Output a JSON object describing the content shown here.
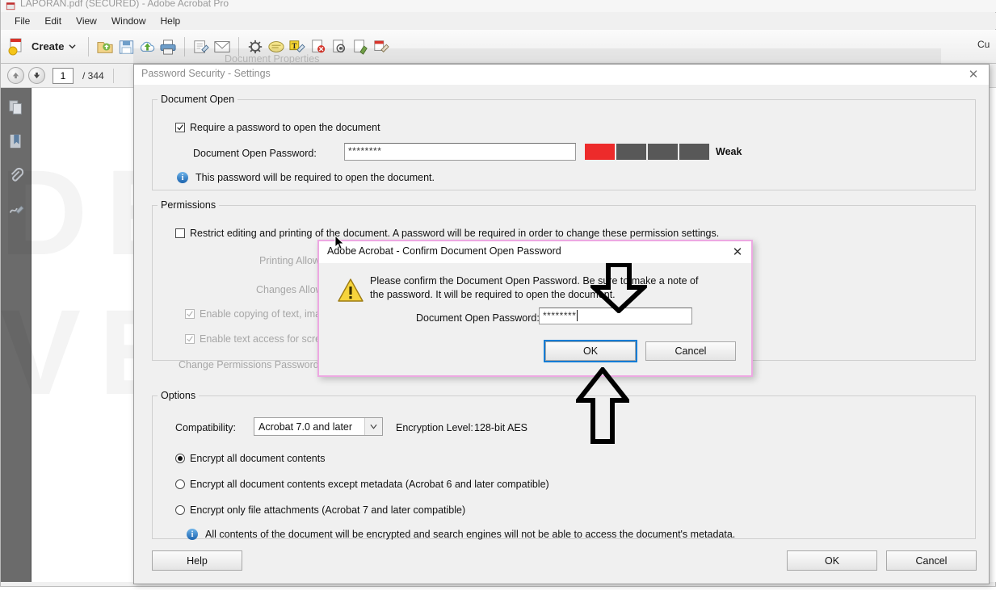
{
  "window": {
    "title": "LAPORAN.pdf (SECURED) - Adobe Acrobat Pro",
    "menu": [
      "File",
      "Edit",
      "View",
      "Window",
      "Help"
    ],
    "toolbar": {
      "create_label": "Create",
      "right_label": "Cu",
      "icons": [
        "create-pdf-icon",
        "open-file-icon",
        "save-icon",
        "upload-cloud-icon",
        "print-icon",
        "sign-icon",
        "email-icon",
        "tools-gear-icon",
        "comment-icon",
        "edit-text-icon",
        "protect-icon",
        "stamp-icon",
        "export-icon",
        "fill-sign-icon"
      ]
    },
    "navbar": {
      "page_current": "1",
      "page_total": "/ 344"
    },
    "rail_icons": [
      "page-thumbnails-icon",
      "bookmarks-icon",
      "attachments-icon",
      "signatures-icon"
    ],
    "watermark": "DEMO VERSION",
    "ghost_tooltip": "Document Properties"
  },
  "settings_dialog": {
    "title": "Password Security - Settings",
    "close_label": "✕",
    "document_open": {
      "legend": "Document Open",
      "require_password_label": "Require a password to open the document",
      "require_password_checked": true,
      "password_label": "Document Open Password:",
      "password_value": "********",
      "strength_label": "Weak",
      "strength_filled": 1,
      "strength_total": 4,
      "strength_color": "#ED2B2B",
      "strength_empty_color": "#585858",
      "info_text": "This password will be required to open the document."
    },
    "permissions": {
      "legend": "Permissions",
      "restrict_label": "Restrict editing and printing of the document. A password will be required in order to change these permission settings.",
      "restrict_checked": false,
      "printing_allowed_label": "Printing Allowed:",
      "changes_allowed_label": "Changes Allowed:",
      "enable_copy_label": "Enable copying of text, image",
      "enable_copy_checked": true,
      "enable_screen_reader_label": "Enable text access for screen r",
      "enable_screen_reader_checked": true,
      "change_perm_password_label": "Change Permissions Password:"
    },
    "options": {
      "legend": "Options",
      "compatibility_label": "Compatibility:",
      "compatibility_value": "Acrobat 7.0 and later",
      "encryption_level_label": "Encryption  Level:",
      "encryption_level_value": "128-bit AES",
      "radios": [
        {
          "label": "Encrypt all document contents",
          "selected": true
        },
        {
          "label": "Encrypt all document contents except metadata (Acrobat 6 and later compatible)",
          "selected": false
        },
        {
          "label": "Encrypt only file attachments (Acrobat 7 and later compatible)",
          "selected": false
        }
      ],
      "info_text": "All contents of the document will be encrypted and search engines will not be able to access the document's metadata."
    },
    "footer": {
      "help_label": "Help",
      "ok_label": "OK",
      "cancel_label": "Cancel"
    }
  },
  "confirm_dialog": {
    "title": "Adobe Acrobat - Confirm Document Open Password",
    "close_label": "✕",
    "message": "Please confirm the Document Open Password. Be sure to make a note of the password. It will be required to open the document.",
    "password_label": "Document Open Password:",
    "password_value": "********",
    "ok_label": "OK",
    "cancel_label": "Cancel",
    "ok_focus_color": "#0C7CD5",
    "border_color": "#EDA8E2"
  },
  "annotations": {
    "arrow_down_name": "arrow-pointing-to-password-field",
    "arrow_up_name": "arrow-pointing-to-ok-button"
  }
}
